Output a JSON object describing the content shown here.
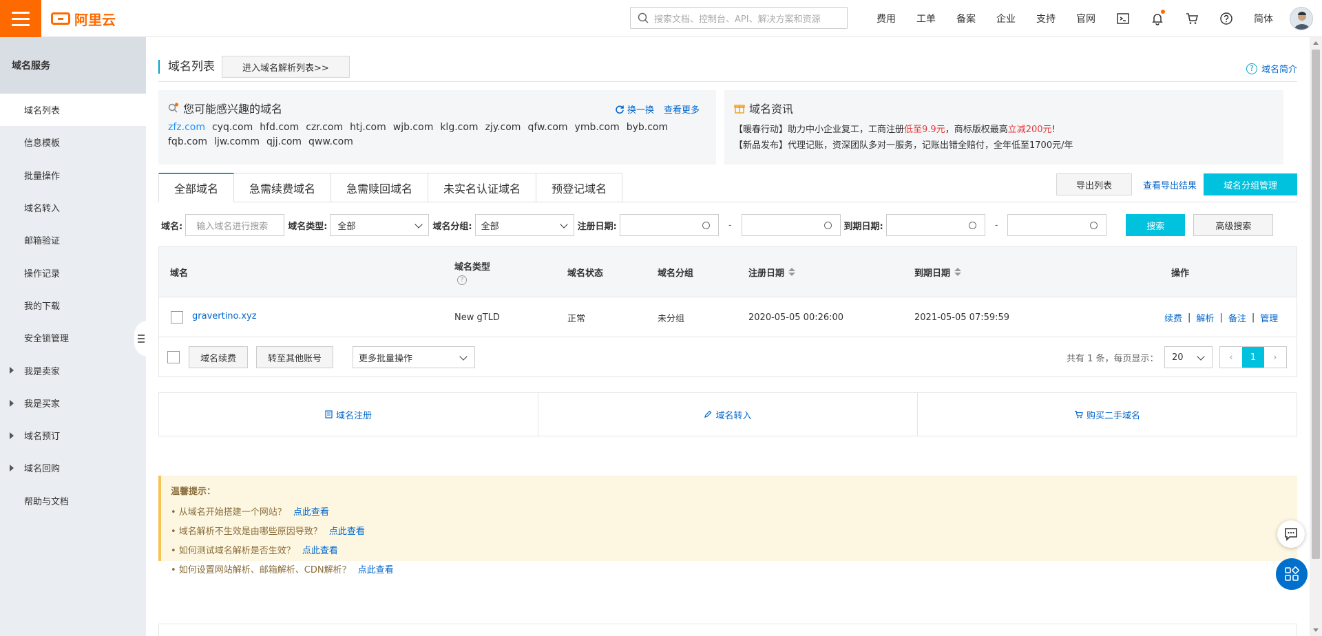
{
  "header": {
    "logo_text": "阿里云",
    "search_placeholder": "搜索文档、控制台、API、解决方案和资源",
    "nav": [
      "费用",
      "工单",
      "备案",
      "企业",
      "支持",
      "官网"
    ],
    "lang": "简体"
  },
  "sidebar": {
    "title": "域名服务",
    "items": [
      {
        "label": "域名列表"
      },
      {
        "label": "信息模板"
      },
      {
        "label": "批量操作"
      },
      {
        "label": "域名转入"
      },
      {
        "label": "邮箱验证"
      },
      {
        "label": "操作记录"
      },
      {
        "label": "我的下载"
      },
      {
        "label": "安全锁管理"
      },
      {
        "label": "我是卖家"
      },
      {
        "label": "我是买家"
      },
      {
        "label": "域名预订"
      },
      {
        "label": "域名回购"
      },
      {
        "label": "帮助与文档"
      }
    ]
  },
  "page": {
    "title": "域名列表",
    "goto_dns_button": "进入域名解析列表>>",
    "intro_link": "域名简介"
  },
  "suggest": {
    "title": "您可能感兴趣的域名",
    "refresh": "换一换",
    "more": "查看更多",
    "domains": [
      "zfz.com",
      "cyq.com",
      "hfd.com",
      "czr.com",
      "htj.com",
      "wjb.com",
      "klg.com",
      "zjy.com",
      "qfw.com",
      "ymb.com",
      "byb.com",
      "fqb.com",
      "ljw.comm",
      "qjj.com",
      "qww.com"
    ]
  },
  "news": {
    "title": "域名资讯",
    "line1_a": "【暖春行动】助力中小企业复工，工商注册",
    "line1_b": "低至9.9元",
    "line1_c": "，商标版权最高",
    "line1_d": "立减200元",
    "line1_e": "!",
    "line2": "【新品发布】代理记账，资深团队多对一服务，记账出错全赔付，全年低至1700元/年"
  },
  "tabs": [
    "全部域名",
    "急需续费域名",
    "急需赎回域名",
    "未实名认证域名",
    "预登记域名"
  ],
  "toolbar": {
    "export_list": "导出列表",
    "view_export": "查看导出结果",
    "group_manage": "域名分组管理"
  },
  "filters": {
    "domain_label": "域名:",
    "domain_placeholder": "输入域名进行搜索",
    "type_label": "域名类型:",
    "type_value": "全部",
    "group_label": "域名分组:",
    "group_value": "全部",
    "reg_label": "注册日期:",
    "exp_label": "到期日期:",
    "dash": "-",
    "search": "搜索",
    "advanced": "高级搜索"
  },
  "table": {
    "headers": {
      "domain": "域名",
      "type": "域名类型",
      "status": "域名状态",
      "group": "域名分组",
      "reg": "注册日期",
      "exp": "到期日期",
      "ops": "操作"
    },
    "rows": [
      {
        "domain": "gravertino.xyz",
        "type": "New gTLD",
        "status": "正常",
        "group": "未分组",
        "reg": "2020-05-05 00:26:00",
        "exp": "2021-05-05 07:59:59",
        "ops": [
          "续费",
          "解析",
          "备注",
          "管理"
        ]
      }
    ],
    "footer": {
      "renew": "域名续费",
      "transfer": "转至其他账号",
      "batch": "更多批量操作",
      "total": "共有 1 条，每页显示：",
      "page_size": "20",
      "current_page": "1"
    }
  },
  "quicklinks": [
    "域名注册",
    "域名转入",
    "购买二手域名"
  ],
  "tips": {
    "title": "温馨提示：",
    "items": [
      {
        "text": "• 从域名开始搭建一个网站？",
        "link": "点此查看"
      },
      {
        "text": "• 域名解析不生效是由哪些原因导致？",
        "link": "点此查看"
      },
      {
        "text": "• 如何测试域名解析是否生效？",
        "link": "点此查看"
      },
      {
        "text": "• 如何设置网站解析、邮箱解析、CDN解析？",
        "link": "点此查看"
      }
    ]
  },
  "colors": {
    "brand": "#ff6a00",
    "primary": "#00c1de",
    "link": "#0066cc",
    "accent": "#00a2ca"
  }
}
